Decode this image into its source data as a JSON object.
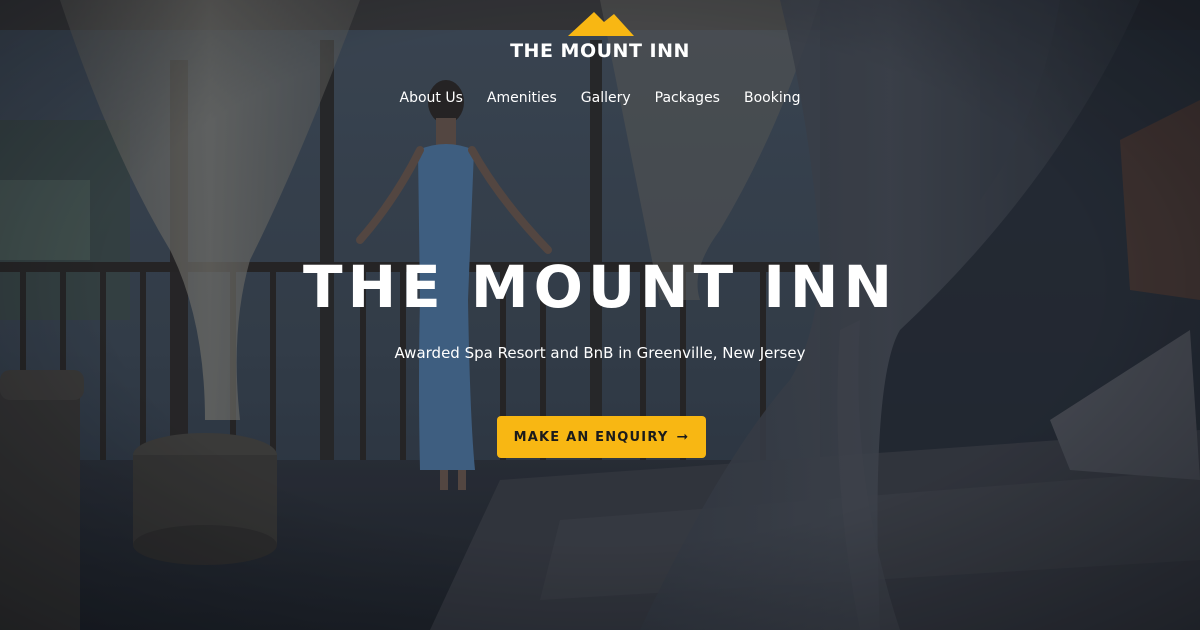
{
  "brand": {
    "name": "THE MOUNT INN",
    "logo_icon": "mountain-icon",
    "accent_color": "#f8b713"
  },
  "nav": {
    "items": [
      {
        "label": "About Us"
      },
      {
        "label": "Amenities"
      },
      {
        "label": "Gallery"
      },
      {
        "label": "Packages"
      },
      {
        "label": "Booking"
      }
    ]
  },
  "hero": {
    "title": "THE MOUNT INN",
    "subtitle": "Awarded Spa Resort and BnB in Greenville, New Jersey",
    "cta_label": "MAKE AN ENQUIRY",
    "cta_icon": "arrow-right-icon",
    "cta_arrow": "➞"
  }
}
